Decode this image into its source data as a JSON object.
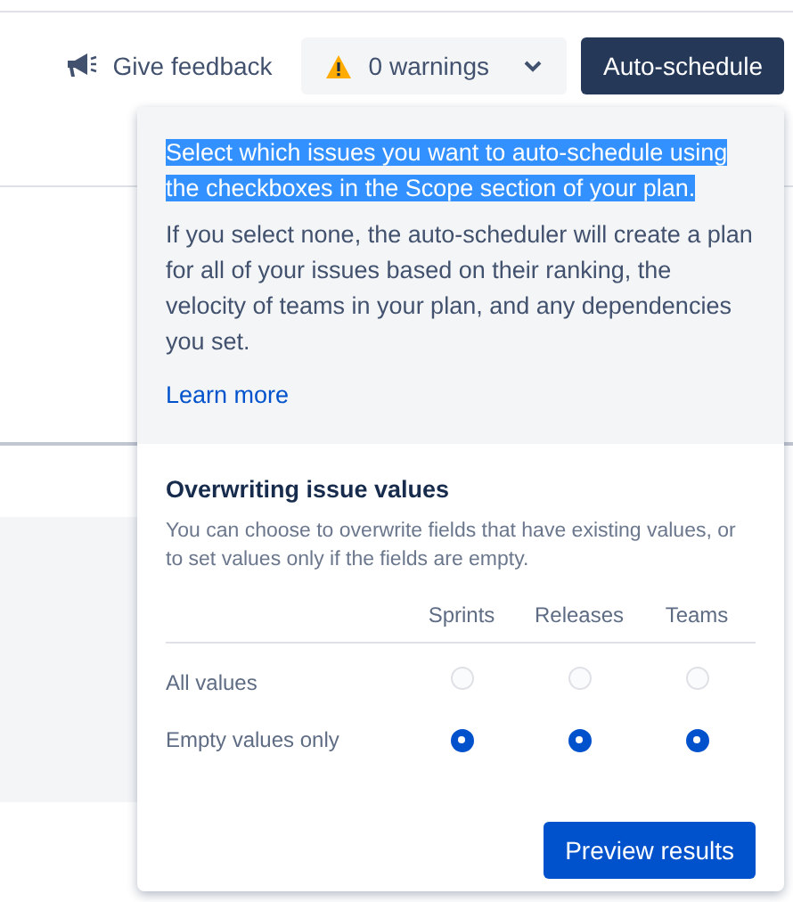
{
  "toolbar": {
    "feedback": "Give feedback",
    "warnings": "0 warnings",
    "auto_schedule": "Auto-schedule"
  },
  "popup": {
    "intro": {
      "text": "Select which issues you want to auto-schedule using the checkboxes in the Scope section of your plan.",
      "highlighted": true
    },
    "description": "If you select none, the auto-scheduler will create a plan for all of your issues based on their ranking, the velocity of teams in your plan, and any dependencies you set.",
    "learn_more": "Learn more",
    "section_title": "Overwriting issue values",
    "section_help": "You can choose to overwrite fields that have existing values, or to set values only if the fields are empty.",
    "columns": [
      "Sprints",
      "Releases",
      "Teams"
    ],
    "rows": [
      {
        "label": "All values",
        "options": [
          {
            "selected": false
          },
          {
            "selected": false
          },
          {
            "selected": false
          }
        ]
      },
      {
        "label": "Empty values only",
        "options": [
          {
            "selected": true
          },
          {
            "selected": true
          },
          {
            "selected": true
          }
        ]
      }
    ],
    "preview_button": "Preview results"
  }
}
